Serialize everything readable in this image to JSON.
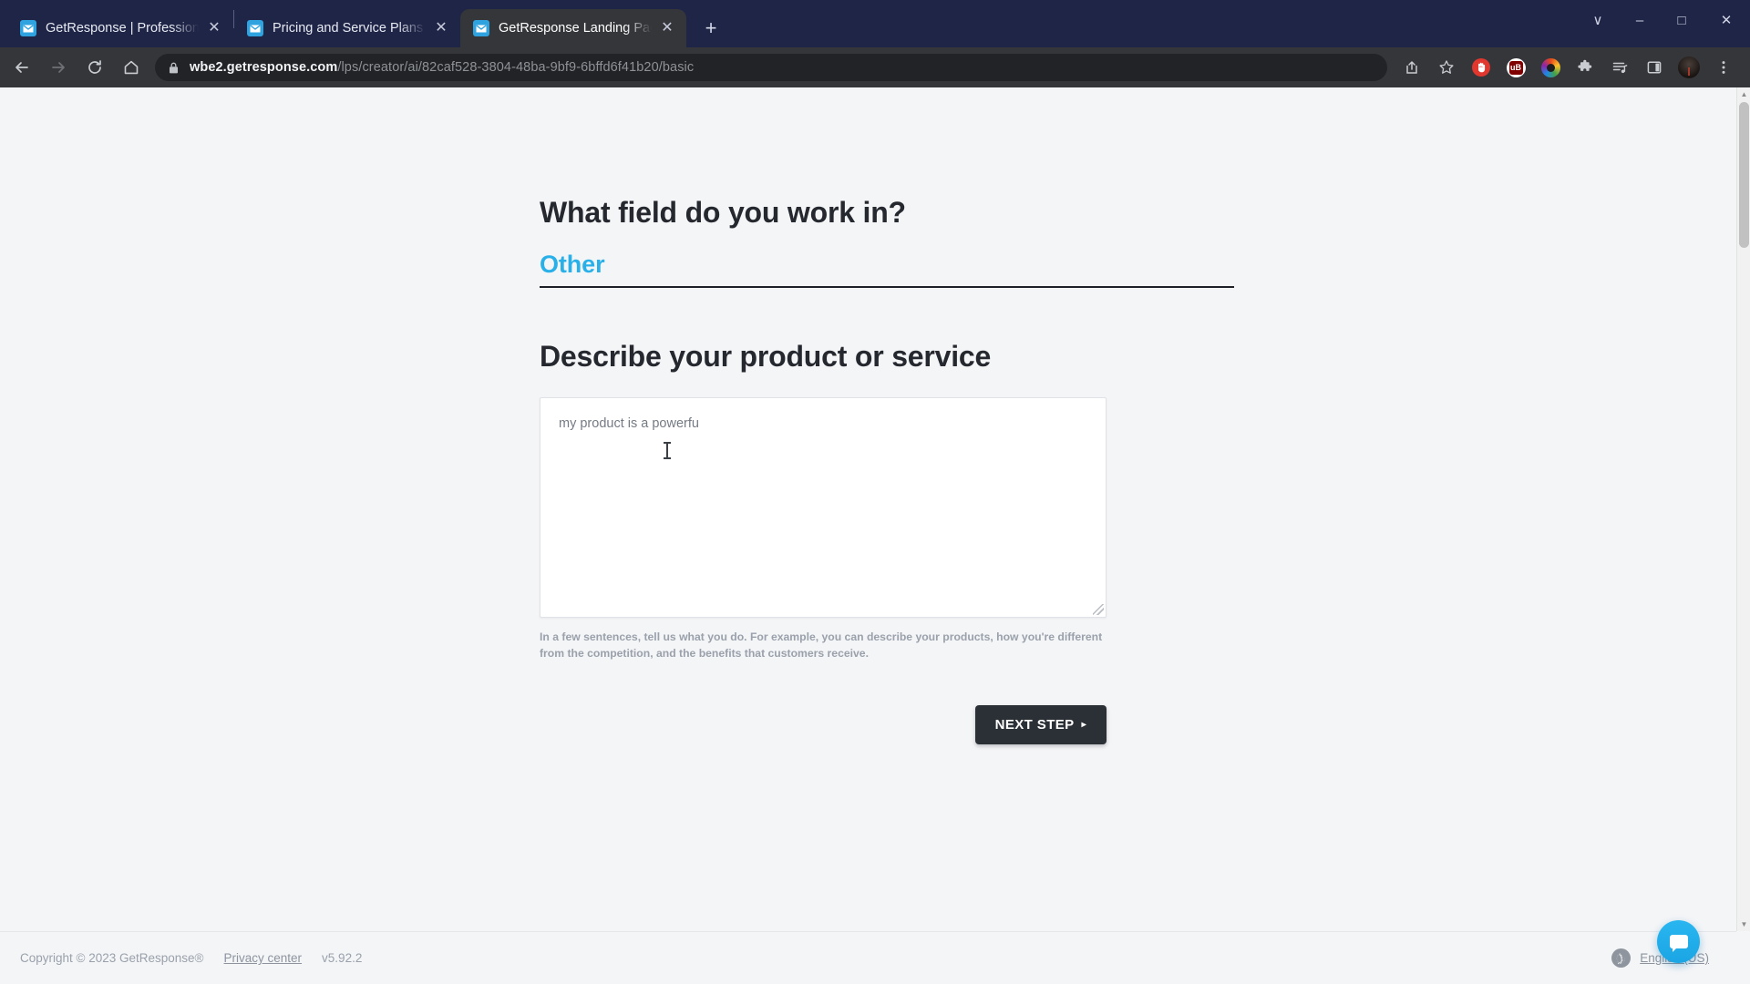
{
  "browser": {
    "tabs": [
      {
        "title": "GetResponse | Professional Ema",
        "favicon": "mail-icon",
        "active": false,
        "closable": true
      },
      {
        "title": "Pricing and Service Plans | GetRe",
        "favicon": "mail-icon",
        "active": false,
        "closable": true
      },
      {
        "title": "GetResponse Landing Pages",
        "favicon": "mail-icon",
        "active": true,
        "closable": true
      }
    ],
    "new_tab_label": "+",
    "window_controls": {
      "search_tabs": "∨",
      "minimize": "–",
      "maximize": "□",
      "close": "✕"
    },
    "nav": {
      "back": "←",
      "forward": "→",
      "reload": "⟳",
      "home": "⌂"
    },
    "omnibox": {
      "lock": "🔒",
      "host": "wbe2.getresponse.com",
      "path": "/lps/creator/ai/82caf528-3804-48ba-9bf9-6bffd6f41b20/basic"
    },
    "toolbar_icons": [
      "share-icon",
      "bookmark-star-icon",
      "red-hand-extension-icon",
      "ublock-origin-icon",
      "color-ring-extension-icon",
      "extensions-puzzle-icon",
      "reading-list-icon",
      "side-panel-icon",
      "profile-avatar-icon",
      "chrome-menu-icon"
    ],
    "ublock_label": "uB"
  },
  "page": {
    "question_1": "What field do you work in?",
    "field_value": "Other",
    "question_2": "Describe your product or service",
    "textarea_value": "my product is a powerfu",
    "textarea_placeholder": "",
    "helper_text": "In a few sentences, tell us what you do. For example, you can describe your products, how you're different from the competition, and the benefits that customers receive.",
    "next_button": "NEXT STEP",
    "next_button_caret": "▸",
    "accent_color": "#29b0e8",
    "button_color": "#2b2f36"
  },
  "footer": {
    "copyright": "Copyright © 2023 GetResponse®",
    "privacy_link": "Privacy center",
    "version": "v5.92.2",
    "language": "English (US)",
    "globe_icon": "🌐"
  },
  "chat": {
    "icon": "chat-bubble-icon"
  }
}
